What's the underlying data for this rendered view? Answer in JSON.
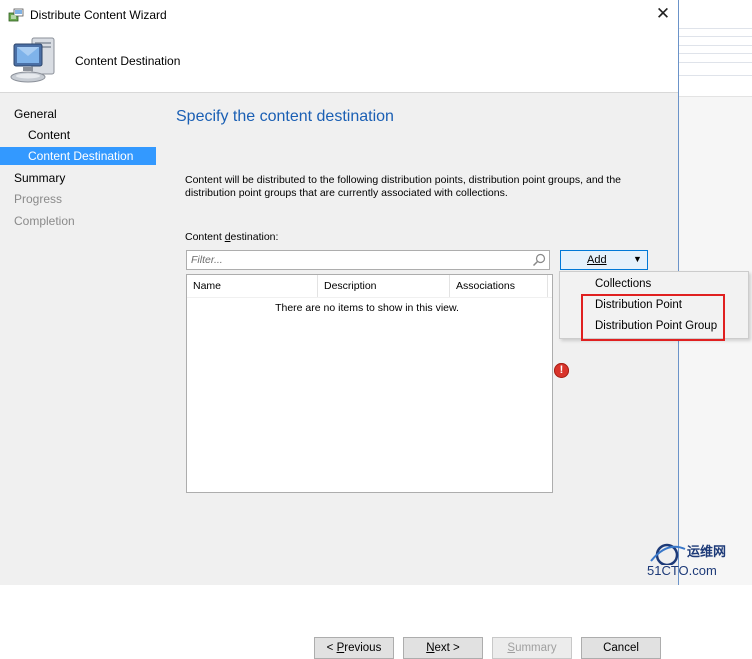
{
  "window": {
    "title": "Distribute Content Wizard",
    "close_glyph": "✕",
    "header_title": "Content Destination"
  },
  "sidebar": {
    "items": [
      {
        "label": "General",
        "state": "normal"
      },
      {
        "label": "Content",
        "state": "normal"
      },
      {
        "label": "Content Destination",
        "state": "selected"
      },
      {
        "label": "Summary",
        "state": "normal"
      },
      {
        "label": "Progress",
        "state": "disabled"
      },
      {
        "label": "Completion",
        "state": "disabled"
      }
    ]
  },
  "main": {
    "heading": "Specify the content destination",
    "description": "Content will be distributed to the following distribution points, distribution point groups, and the distribution point groups that are currently associated with collections.",
    "destination_label_pre": "Content ",
    "destination_label_key": "d",
    "destination_label_post": "estination:",
    "filter_placeholder": "Filter...",
    "columns": [
      "Name",
      "Description",
      "Associations"
    ],
    "empty_message": "There are no items to show in this view.",
    "add_button": "Add",
    "add_arrow": "▼",
    "add_menu": [
      "Collections",
      "Distribution Point",
      "Distribution Point Group"
    ],
    "error_glyph": "!"
  },
  "footer": {
    "previous_prefix": "< ",
    "previous_key": "P",
    "previous_rest": "revious",
    "next_key": "N",
    "next_rest": "ext >",
    "summary_key": "S",
    "summary_rest": "ummary",
    "cancel": "Cancel"
  },
  "watermark": {
    "text": "运维网",
    "sub": "51CTO.com"
  },
  "colors": {
    "accent": "#3399ff",
    "heading": "#1a5fb4",
    "highlight": "#e02020",
    "error": "#d9342b"
  }
}
